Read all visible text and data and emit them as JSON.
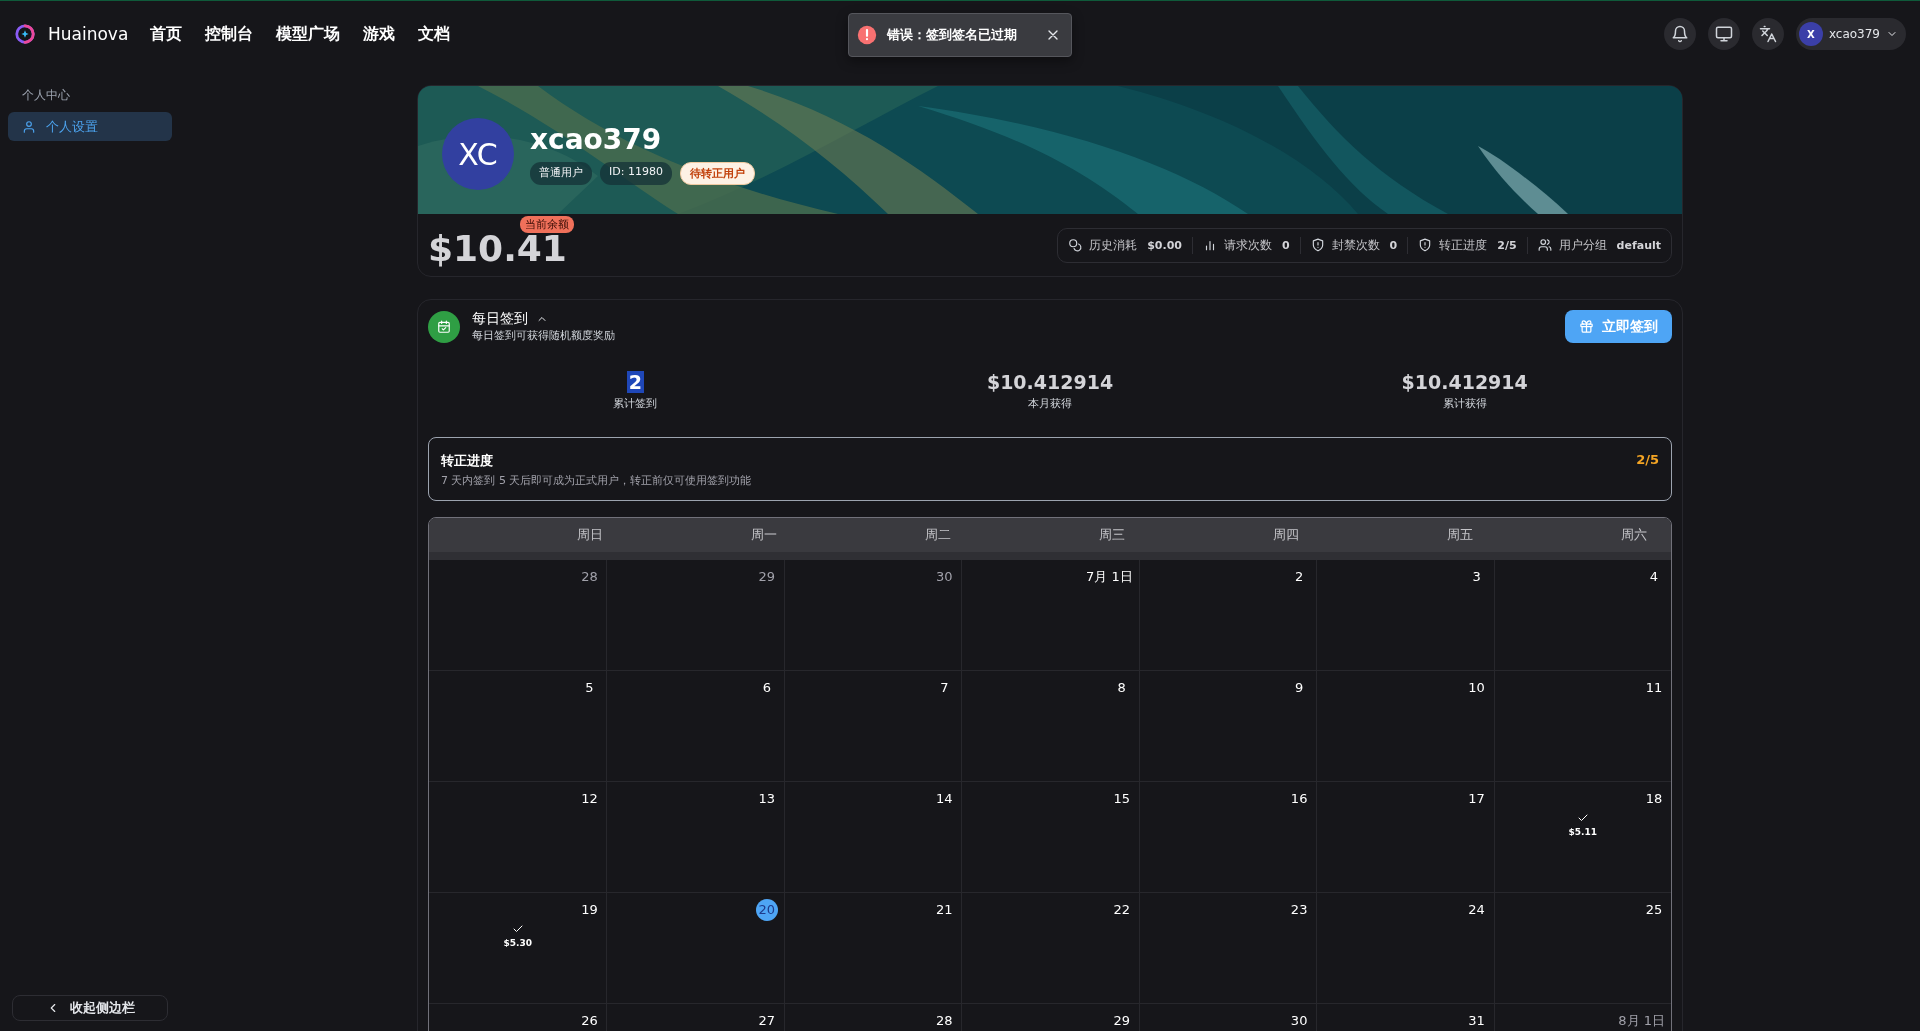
{
  "header": {
    "brand": "Huainova",
    "nav": [
      {
        "label": "首页"
      },
      {
        "label": "控制台"
      },
      {
        "label": "模型广场"
      },
      {
        "label": "游戏"
      },
      {
        "label": "文档"
      }
    ],
    "user": {
      "initial": "X",
      "name": "xcao379"
    }
  },
  "toast": {
    "message": "错误：签到签名已过期"
  },
  "sidebar": {
    "section": "个人中心",
    "items": [
      {
        "label": "个人设置",
        "selected": true
      }
    ],
    "collapse": "收起侧边栏"
  },
  "profile": {
    "initials": "XC",
    "username": "xcao379",
    "tags": [
      {
        "text": "普通用户",
        "kind": "plain"
      },
      {
        "text": "ID: 11980",
        "kind": "plain"
      },
      {
        "text": "待转正用户",
        "kind": "warning"
      }
    ],
    "balance": "$10.41",
    "balance_label": "当前余额",
    "stats": [
      {
        "kind": "spending",
        "label": "历史消耗",
        "value": "$0.00"
      },
      {
        "kind": "requests",
        "label": "请求次数",
        "value": "0"
      },
      {
        "kind": "bans",
        "label": "封禁次数",
        "value": "0"
      },
      {
        "kind": "progress",
        "label": "转正进度",
        "value": "2/5"
      },
      {
        "kind": "group",
        "label": "用户分组",
        "value": "default"
      }
    ]
  },
  "checkin": {
    "title": "每日签到",
    "expanded": true,
    "subtitle": "每日签到可获得随机额度奖励",
    "button": "立即签到",
    "summary": [
      {
        "value": "2",
        "label": "累计签到"
      },
      {
        "value": "$10.412914",
        "label": "本月获得"
      },
      {
        "value": "$10.412914",
        "label": "累计获得"
      }
    ],
    "progress": {
      "title": "转正进度",
      "description": "7 天内签到 5 天后即可成为正式用户，转正前仅可使用签到功能",
      "value": "2/5"
    },
    "calendar": {
      "weekdays": [
        "周日",
        "周一",
        "周二",
        "周三",
        "周四",
        "周五",
        "周六"
      ],
      "weeks": [
        [
          {
            "day": "28",
            "muted": true
          },
          {
            "day": "29",
            "muted": true
          },
          {
            "day": "30",
            "muted": true
          },
          {
            "day": "7月 1日",
            "muted": false
          },
          {
            "day": "2",
            "muted": false
          },
          {
            "day": "3",
            "muted": false
          },
          {
            "day": "4",
            "muted": false
          }
        ],
        [
          {
            "day": "5",
            "muted": false
          },
          {
            "day": "6",
            "muted": false
          },
          {
            "day": "7",
            "muted": false
          },
          {
            "day": "8",
            "muted": false
          },
          {
            "day": "9",
            "muted": false
          },
          {
            "day": "10",
            "muted": false
          },
          {
            "day": "11",
            "muted": false
          }
        ],
        [
          {
            "day": "12",
            "muted": false
          },
          {
            "day": "13",
            "muted": false
          },
          {
            "day": "14",
            "muted": false
          },
          {
            "day": "15",
            "muted": false
          },
          {
            "day": "16",
            "muted": false
          },
          {
            "day": "17",
            "muted": false
          },
          {
            "day": "18",
            "muted": false,
            "checked": true,
            "reward": "$5.11"
          }
        ],
        [
          {
            "day": "19",
            "muted": false,
            "checked": true,
            "reward": "$5.30"
          },
          {
            "day": "20",
            "muted": false,
            "today": true
          },
          {
            "day": "21",
            "muted": false
          },
          {
            "day": "22",
            "muted": false
          },
          {
            "day": "23",
            "muted": false
          },
          {
            "day": "24",
            "muted": false
          },
          {
            "day": "25",
            "muted": false
          }
        ],
        [
          {
            "day": "26",
            "muted": false
          },
          {
            "day": "27",
            "muted": false
          },
          {
            "day": "28",
            "muted": false
          },
          {
            "day": "29",
            "muted": false
          },
          {
            "day": "30",
            "muted": false
          },
          {
            "day": "31",
            "muted": false
          },
          {
            "day": "8月 1日",
            "muted": true
          }
        ]
      ]
    }
  }
}
